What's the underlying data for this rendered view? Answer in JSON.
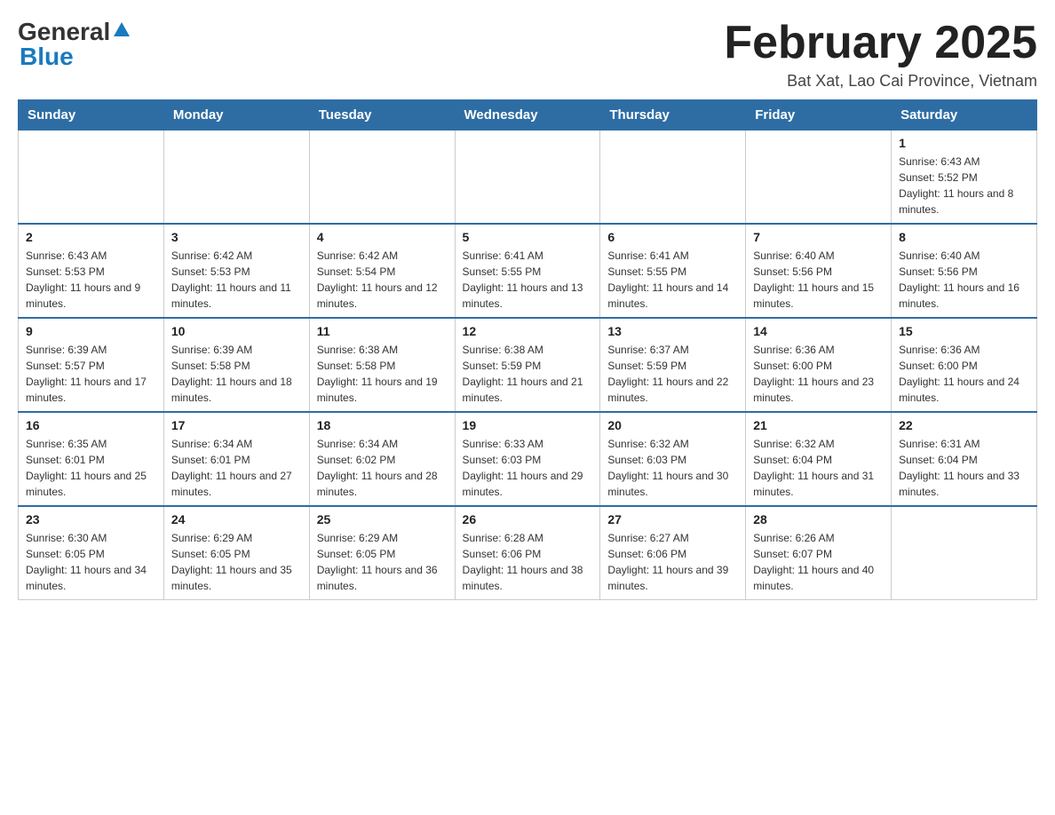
{
  "logo": {
    "general": "General",
    "blue": "Blue",
    "arrow": "▲"
  },
  "title": "February 2025",
  "subtitle": "Bat Xat, Lao Cai Province, Vietnam",
  "weekdays": [
    "Sunday",
    "Monday",
    "Tuesday",
    "Wednesday",
    "Thursday",
    "Friday",
    "Saturday"
  ],
  "weeks": [
    [
      {
        "day": "",
        "info": ""
      },
      {
        "day": "",
        "info": ""
      },
      {
        "day": "",
        "info": ""
      },
      {
        "day": "",
        "info": ""
      },
      {
        "day": "",
        "info": ""
      },
      {
        "day": "",
        "info": ""
      },
      {
        "day": "1",
        "info": "Sunrise: 6:43 AM\nSunset: 5:52 PM\nDaylight: 11 hours and 8 minutes."
      }
    ],
    [
      {
        "day": "2",
        "info": "Sunrise: 6:43 AM\nSunset: 5:53 PM\nDaylight: 11 hours and 9 minutes."
      },
      {
        "day": "3",
        "info": "Sunrise: 6:42 AM\nSunset: 5:53 PM\nDaylight: 11 hours and 11 minutes."
      },
      {
        "day": "4",
        "info": "Sunrise: 6:42 AM\nSunset: 5:54 PM\nDaylight: 11 hours and 12 minutes."
      },
      {
        "day": "5",
        "info": "Sunrise: 6:41 AM\nSunset: 5:55 PM\nDaylight: 11 hours and 13 minutes."
      },
      {
        "day": "6",
        "info": "Sunrise: 6:41 AM\nSunset: 5:55 PM\nDaylight: 11 hours and 14 minutes."
      },
      {
        "day": "7",
        "info": "Sunrise: 6:40 AM\nSunset: 5:56 PM\nDaylight: 11 hours and 15 minutes."
      },
      {
        "day": "8",
        "info": "Sunrise: 6:40 AM\nSunset: 5:56 PM\nDaylight: 11 hours and 16 minutes."
      }
    ],
    [
      {
        "day": "9",
        "info": "Sunrise: 6:39 AM\nSunset: 5:57 PM\nDaylight: 11 hours and 17 minutes."
      },
      {
        "day": "10",
        "info": "Sunrise: 6:39 AM\nSunset: 5:58 PM\nDaylight: 11 hours and 18 minutes."
      },
      {
        "day": "11",
        "info": "Sunrise: 6:38 AM\nSunset: 5:58 PM\nDaylight: 11 hours and 19 minutes."
      },
      {
        "day": "12",
        "info": "Sunrise: 6:38 AM\nSunset: 5:59 PM\nDaylight: 11 hours and 21 minutes."
      },
      {
        "day": "13",
        "info": "Sunrise: 6:37 AM\nSunset: 5:59 PM\nDaylight: 11 hours and 22 minutes."
      },
      {
        "day": "14",
        "info": "Sunrise: 6:36 AM\nSunset: 6:00 PM\nDaylight: 11 hours and 23 minutes."
      },
      {
        "day": "15",
        "info": "Sunrise: 6:36 AM\nSunset: 6:00 PM\nDaylight: 11 hours and 24 minutes."
      }
    ],
    [
      {
        "day": "16",
        "info": "Sunrise: 6:35 AM\nSunset: 6:01 PM\nDaylight: 11 hours and 25 minutes."
      },
      {
        "day": "17",
        "info": "Sunrise: 6:34 AM\nSunset: 6:01 PM\nDaylight: 11 hours and 27 minutes."
      },
      {
        "day": "18",
        "info": "Sunrise: 6:34 AM\nSunset: 6:02 PM\nDaylight: 11 hours and 28 minutes."
      },
      {
        "day": "19",
        "info": "Sunrise: 6:33 AM\nSunset: 6:03 PM\nDaylight: 11 hours and 29 minutes."
      },
      {
        "day": "20",
        "info": "Sunrise: 6:32 AM\nSunset: 6:03 PM\nDaylight: 11 hours and 30 minutes."
      },
      {
        "day": "21",
        "info": "Sunrise: 6:32 AM\nSunset: 6:04 PM\nDaylight: 11 hours and 31 minutes."
      },
      {
        "day": "22",
        "info": "Sunrise: 6:31 AM\nSunset: 6:04 PM\nDaylight: 11 hours and 33 minutes."
      }
    ],
    [
      {
        "day": "23",
        "info": "Sunrise: 6:30 AM\nSunset: 6:05 PM\nDaylight: 11 hours and 34 minutes."
      },
      {
        "day": "24",
        "info": "Sunrise: 6:29 AM\nSunset: 6:05 PM\nDaylight: 11 hours and 35 minutes."
      },
      {
        "day": "25",
        "info": "Sunrise: 6:29 AM\nSunset: 6:05 PM\nDaylight: 11 hours and 36 minutes."
      },
      {
        "day": "26",
        "info": "Sunrise: 6:28 AM\nSunset: 6:06 PM\nDaylight: 11 hours and 38 minutes."
      },
      {
        "day": "27",
        "info": "Sunrise: 6:27 AM\nSunset: 6:06 PM\nDaylight: 11 hours and 39 minutes."
      },
      {
        "day": "28",
        "info": "Sunrise: 6:26 AM\nSunset: 6:07 PM\nDaylight: 11 hours and 40 minutes."
      },
      {
        "day": "",
        "info": ""
      }
    ]
  ]
}
